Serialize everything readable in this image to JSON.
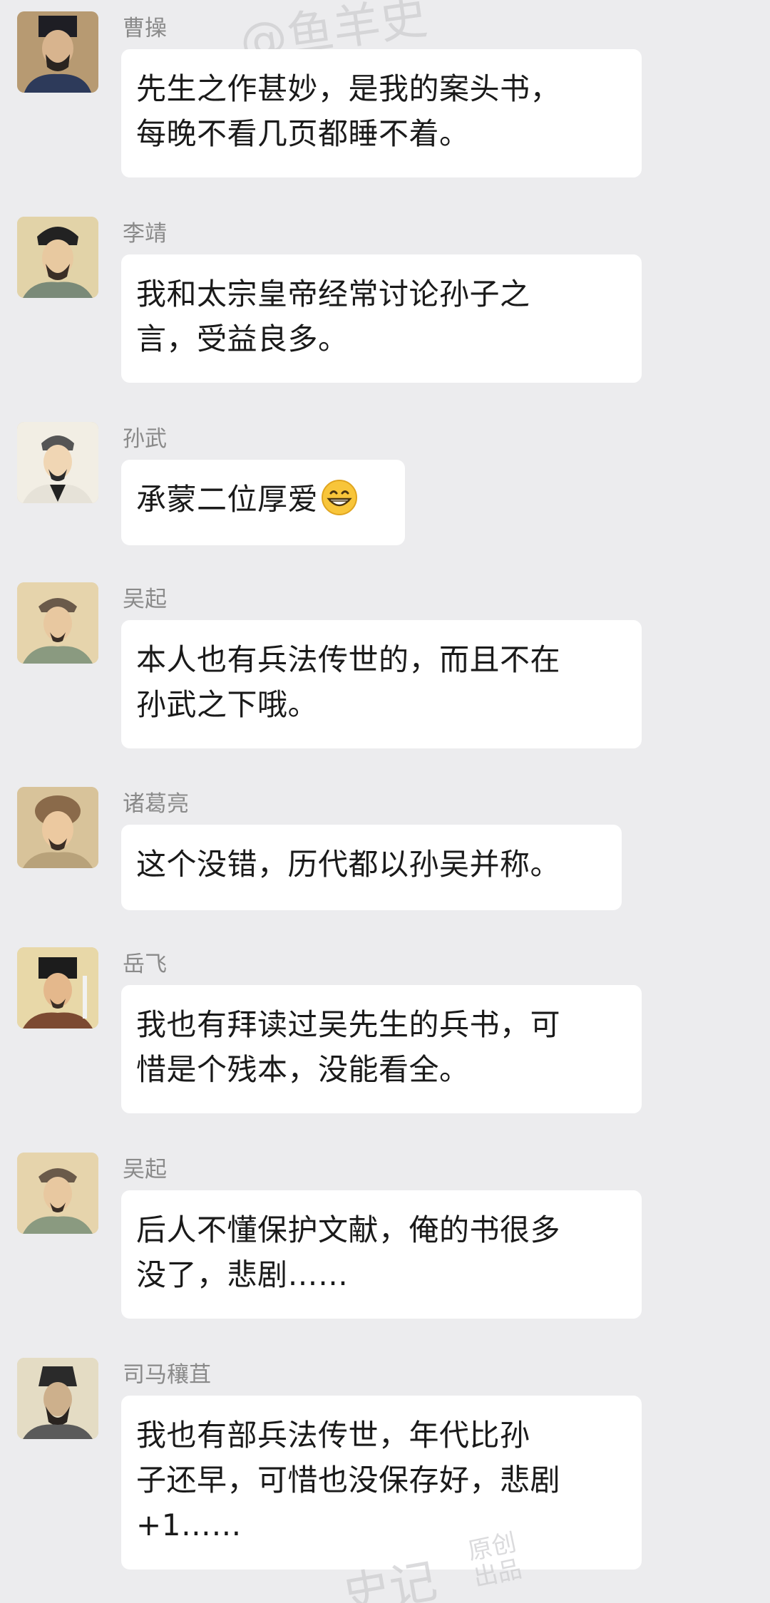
{
  "messages": [
    {
      "sender": "曹操",
      "text": "先生之作甚妙，是我的案头书，\n每晚不看几页都睡不着。"
    },
    {
      "sender": "李靖",
      "text": "我和太宗皇帝经常讨论孙子之\n言，受益良多。"
    },
    {
      "sender": "孙武",
      "text": "承蒙二位厚爱"
    },
    {
      "sender": "吴起",
      "text": "本人也有兵法传世的，而且不在\n孙武之下哦。"
    },
    {
      "sender": "诸葛亮",
      "text": "这个没错，历代都以孙吴并称。"
    },
    {
      "sender": "岳飞",
      "text": "我也有拜读过吴先生的兵书，可\n惜是个残本，没能看全。"
    },
    {
      "sender": "吴起",
      "text": "后人不懂保护文献，俺的书很多\n没了，悲剧……"
    },
    {
      "sender": "司马穰苴",
      "text": "我也有部兵法传世，年代比孙\n子还早，可惜也没保存好，悲剧\n+1……"
    }
  ],
  "emoji": {
    "name": "grinning-face-icon"
  },
  "watermarks": {
    "top": "@鱼羊史",
    "bottom": "史记",
    "stamp": "原创出品"
  },
  "colors": {
    "background": "#ececee",
    "bubble": "#ffffff",
    "sender_name": "#8a8a8a",
    "text": "#1a1a1a"
  }
}
